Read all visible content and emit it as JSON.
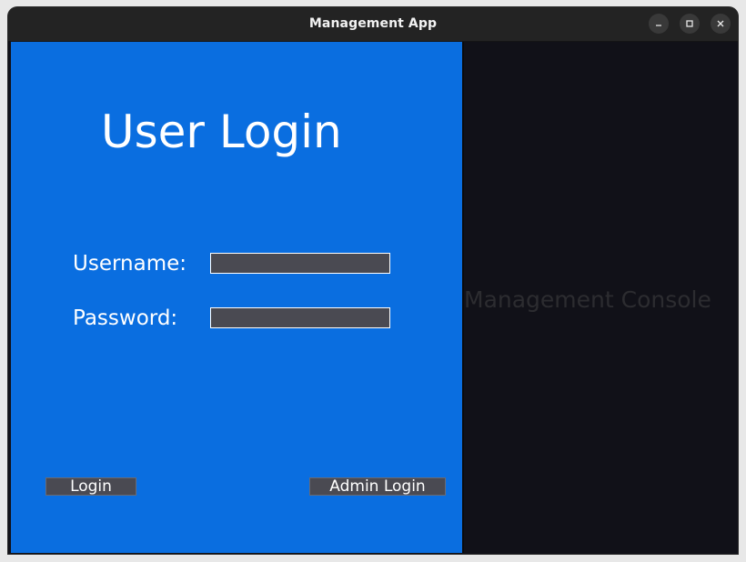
{
  "window": {
    "title": "Management App",
    "controls": {
      "minimize_icon": "minimize-icon",
      "maximize_icon": "maximize-icon",
      "close_icon": "close-icon"
    }
  },
  "login_panel": {
    "heading": "User Login",
    "username_label": "Username:",
    "username_value": "",
    "password_label": "Password:",
    "password_value": "",
    "login_button": "Login",
    "admin_login_button": "Admin Login"
  },
  "console_panel": {
    "label": "Management Console"
  },
  "colors": {
    "login_panel_bg": "#0a6ee0",
    "console_bg": "#111118",
    "input_bg": "#4a4a52",
    "titlebar_bg": "#232323"
  }
}
